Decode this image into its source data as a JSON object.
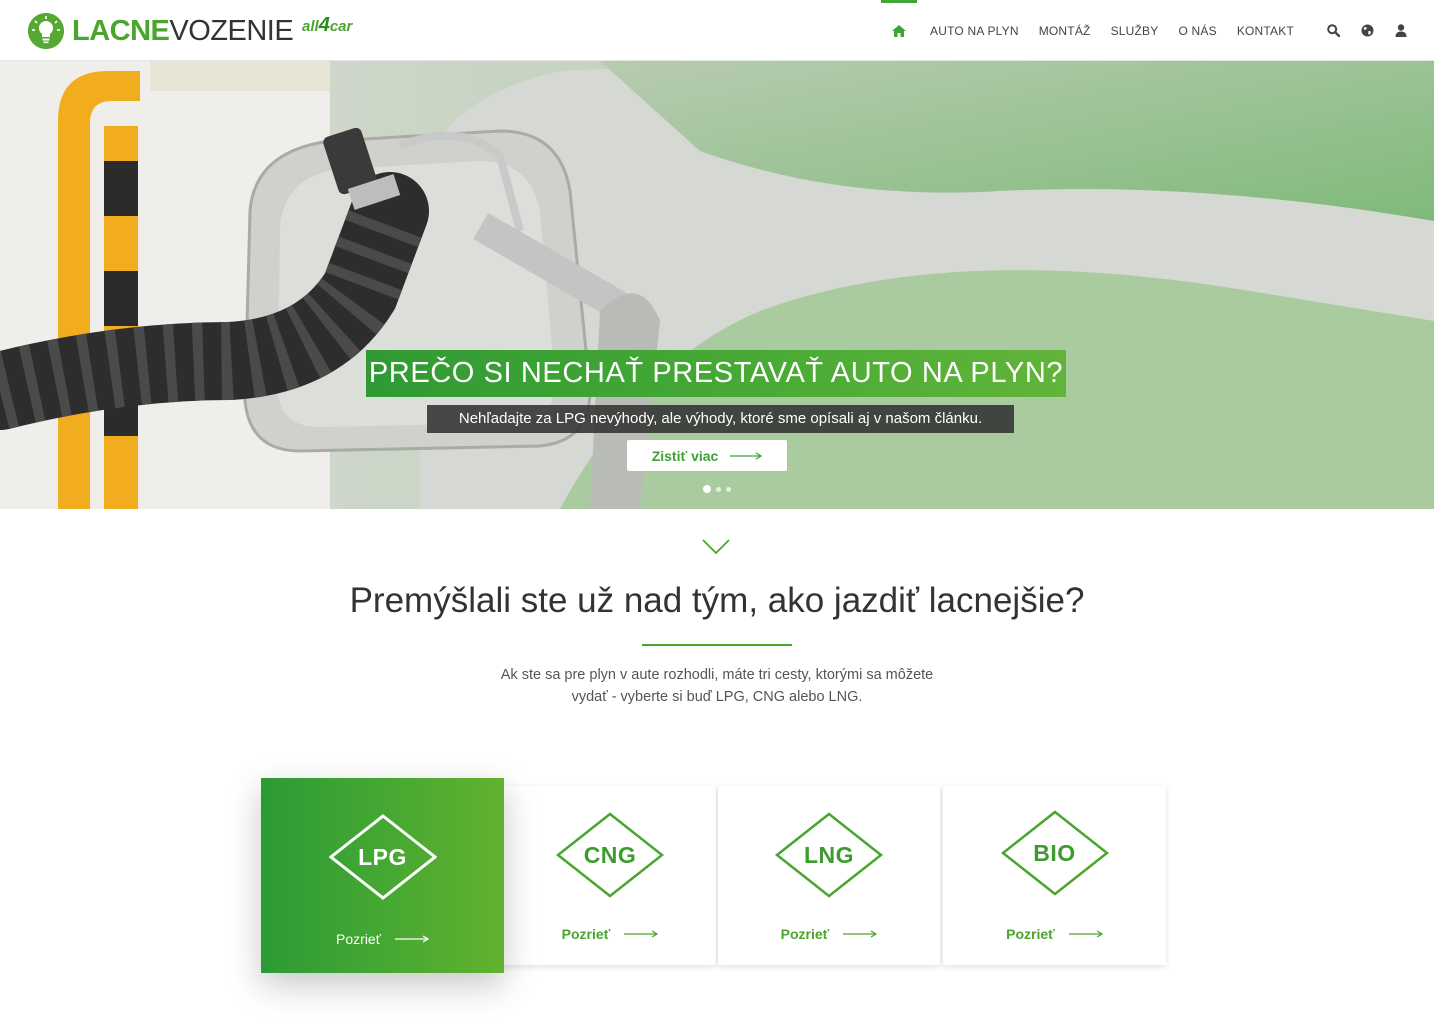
{
  "header": {
    "logo_bold": "LACNE",
    "logo_light": "VOZENIE",
    "partner_pre": "all",
    "partner_num": "4",
    "partner_post": "car",
    "nav": [
      "AUTO NA PLYN",
      "MONTÁŽ",
      "SLUŽBY",
      "O NÁS",
      "KONTAKT"
    ],
    "icons": [
      "home-icon",
      "search-icon",
      "globe-icon",
      "user-icon"
    ]
  },
  "hero": {
    "title": "PREČO SI NECHAŤ PRESTAVAŤ AUTO NA PLYN?",
    "subtitle": "Nehľadajte za LPG nevýhody, ale výhody, ktoré sme opísali aj v našom článku.",
    "button": "Zistiť viac",
    "slides": 3,
    "active_slide": 1
  },
  "intro": {
    "title": "Premýšlali ste už nad tým, ako jazdiť lacnejšie?",
    "text": "Ak ste sa pre plyn v aute rozhodli, máte tri cesty, ktorými sa môžete vydať - vyberte si buď LPG, CNG alebo LNG."
  },
  "fuels": [
    {
      "label": "LPG",
      "link": "Pozrieť",
      "active": true
    },
    {
      "label": "CNG",
      "link": "Pozrieť",
      "active": false
    },
    {
      "label": "LNG",
      "link": "Pozrieť",
      "active": false
    },
    {
      "label": "BIO",
      "link": "Pozrieť",
      "active": false
    }
  ],
  "colors": {
    "accent": "#4aa52d",
    "accent_dark": "#2d9a35",
    "text": "#333333"
  }
}
